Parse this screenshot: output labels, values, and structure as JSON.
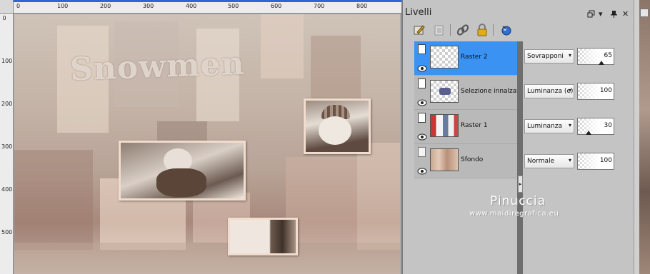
{
  "canvas": {
    "ruler_top_labels": [
      "0",
      "100",
      "200",
      "300",
      "400",
      "500",
      "600",
      "700",
      "800"
    ],
    "ruler_left_labels": [
      "0",
      "100",
      "200",
      "300",
      "400",
      "500"
    ],
    "title_art": "Snowmen"
  },
  "panel": {
    "title": "Livelli",
    "header_icons": [
      "restore-icon",
      "menu-arrow-icon",
      "pin-icon",
      "close-icon"
    ],
    "toolbar_icons": [
      "new-raster-layer-icon",
      "new-mask-icon",
      "link-icon",
      "lock-icon",
      "blue-ball-icon"
    ],
    "layers": [
      {
        "name": "Raster 2",
        "blend": "Sovrapponi",
        "opacity": "65",
        "selected": true
      },
      {
        "name": "Selezione innalzata",
        "blend": "Luminanza (e)",
        "opacity": "100",
        "selected": false
      },
      {
        "name": "Raster 1",
        "blend": "Luminanza",
        "opacity": "30",
        "selected": false
      },
      {
        "name": "Sfondo",
        "blend": "Normale",
        "opacity": "100",
        "selected": false
      }
    ],
    "watermark": {
      "name": "Pinuccia",
      "url": "www.maidiregrafica.eu"
    }
  },
  "colors": {
    "selection": "#3a93f2",
    "ruler_bar": "#2f66d6",
    "panel_bg": "#c4c4c4"
  }
}
